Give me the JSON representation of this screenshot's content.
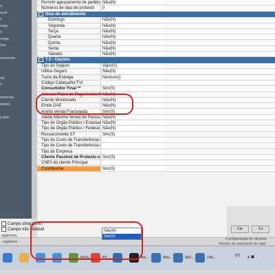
{
  "left_nav": [
    "a",
    "ocal",
    "o",
    "rega",
    "o",
    "rrega",
    "rias",
    "",
    "ovimento",
    "",
    "",
    "ral",
    "s",
    "",
    "erencias",
    "dades",
    "",
    "Lojas"
  ],
  "left_bottom": {
    "label": "rigatórios"
  },
  "properties": [
    {
      "name": "Permitir agrupamento de pedidos",
      "value": "Não(N)"
    },
    {
      "name": "Números de dias de protesto",
      "value": "0"
    },
    {
      "section": "Dias de atendimento",
      "toggle": "-"
    },
    {
      "name": "Domingo",
      "value": "Não(N)",
      "sub": true
    },
    {
      "name": "Segunda",
      "value": "Não(N)",
      "sub": true
    },
    {
      "name": "Terça",
      "value": "Não(N)",
      "sub": true
    },
    {
      "name": "Quarta",
      "value": "Não(N)",
      "sub": true
    },
    {
      "name": "Quinta",
      "value": "Não(N)",
      "sub": true
    },
    {
      "name": "Sexta",
      "value": "Não(N)",
      "sub": true
    },
    {
      "name": "Sábado",
      "value": "Não(N)",
      "sub": true
    },
    {
      "section": "7.2 - Opções",
      "toggle": "-"
    },
    {
      "name": "Tipo do Seguro",
      "value": "Valor(V)"
    },
    {
      "name": "Utiliza Seguro",
      "value": "Não(N)"
    },
    {
      "name": "Turno de Entrega",
      "value": "Nenhum()"
    },
    {
      "name": "Código Cabeçalho TVI",
      "value": ""
    },
    {
      "name": "Consumidor Final **",
      "value": "Sim(S)",
      "bold": true
    },
    {
      "name": "Acessar Plano de Pagamentos Ne",
      "value": "Não(N)"
    },
    {
      "name": "Cliente Monitorado",
      "value": "Não(N)"
    },
    {
      "name": "Emite DAE",
      "value": "Não(N)"
    },
    {
      "name": "Aceita Venda Fracionada",
      "value": "Sim(S)"
    },
    {
      "name": "Valida Máxima Venda de Pessoa F",
      "value": "Não(N)"
    },
    {
      "name": "Tipo de Órgão Público / Estadual",
      "value": "Não(N)"
    },
    {
      "name": "Tipo de Órgão Público / Federal",
      "value": "Não(N)"
    },
    {
      "name": "Ressarcimento ST",
      "value": "Sim(S)"
    },
    {
      "name": "Tipo de Custo de Transferência de",
      "value": ""
    },
    {
      "name": "Tipo de Custo de Transferência en",
      "value": ""
    },
    {
      "name": "Tipo de Empresa",
      "value": ""
    },
    {
      "name": "Cliente Passível de Protesto o",
      "value": "Sim(S)",
      "bold": true
    },
    {
      "name": "CNPJ do cliente Principal",
      "value": ""
    },
    {
      "name": "Contribuinte",
      "value": "Sim(S)",
      "selected": true
    }
  ],
  "dropdown": {
    "options": [
      "Não(N)",
      "Sim(S)"
    ],
    "selected": "Sim(S)"
  },
  "checkboxes": [
    "Campo obrigatório",
    "Campo não editável"
  ],
  "statusbar": {
    "left": "registros",
    "right1": "Configuração do dicioná",
    "right2": "Versão do dicionário de dad"
  },
  "taskbar": {
    "items": [
      {
        "label": "",
        "icon": "windows-start-icon",
        "color": "#3a7bd5"
      },
      {
        "label": "",
        "icon": "folder-icon",
        "color": "#e8b04a"
      },
      {
        "label": "",
        "icon": "pc-icon",
        "color": "#4a90d9"
      },
      {
        "label": "",
        "icon": "pc-icon-2",
        "color": "#4a90d9"
      },
      {
        "label": "MXS...",
        "icon": "frog-icon",
        "color": "#5a9a3a"
      },
      {
        "label": "PC ...",
        "icon": "chrome-icon",
        "color": "#db4437"
      },
      {
        "label": "",
        "icon": "app-icon",
        "color": "#2c6fb0"
      },
      {
        "label": "Ad...",
        "icon": "terminal-icon",
        "color": "#222222"
      },
      {
        "label": "Win...",
        "icon": "winthor-icon",
        "color": "#3a6fb0"
      },
      {
        "label": "302...",
        "icon": "winthor-icon-2",
        "color": "#3a6fb0"
      },
      {
        "label": "145...",
        "icon": "winthor-icon-3",
        "color": "#3a6fb0"
      }
    ],
    "tray": "PT"
  },
  "dialog_buttons": [
    "Car",
    "Ca"
  ]
}
